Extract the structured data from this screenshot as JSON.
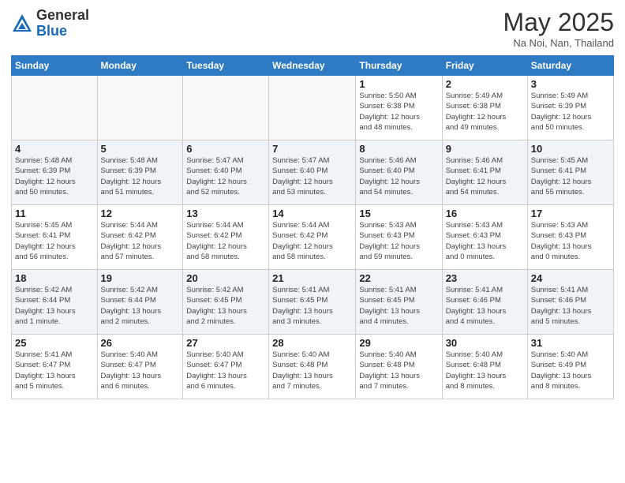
{
  "header": {
    "logo_general": "General",
    "logo_blue": "Blue",
    "month": "May 2025",
    "location": "Na Noi, Nan, Thailand"
  },
  "days_of_week": [
    "Sunday",
    "Monday",
    "Tuesday",
    "Wednesday",
    "Thursday",
    "Friday",
    "Saturday"
  ],
  "weeks": [
    [
      {
        "num": "",
        "info": "",
        "empty": true
      },
      {
        "num": "",
        "info": "",
        "empty": true
      },
      {
        "num": "",
        "info": "",
        "empty": true
      },
      {
        "num": "",
        "info": "",
        "empty": true
      },
      {
        "num": "1",
        "info": "Sunrise: 5:50 AM\nSunset: 6:38 PM\nDaylight: 12 hours\nand 48 minutes."
      },
      {
        "num": "2",
        "info": "Sunrise: 5:49 AM\nSunset: 6:38 PM\nDaylight: 12 hours\nand 49 minutes."
      },
      {
        "num": "3",
        "info": "Sunrise: 5:49 AM\nSunset: 6:39 PM\nDaylight: 12 hours\nand 50 minutes."
      }
    ],
    [
      {
        "num": "4",
        "info": "Sunrise: 5:48 AM\nSunset: 6:39 PM\nDaylight: 12 hours\nand 50 minutes."
      },
      {
        "num": "5",
        "info": "Sunrise: 5:48 AM\nSunset: 6:39 PM\nDaylight: 12 hours\nand 51 minutes."
      },
      {
        "num": "6",
        "info": "Sunrise: 5:47 AM\nSunset: 6:40 PM\nDaylight: 12 hours\nand 52 minutes."
      },
      {
        "num": "7",
        "info": "Sunrise: 5:47 AM\nSunset: 6:40 PM\nDaylight: 12 hours\nand 53 minutes."
      },
      {
        "num": "8",
        "info": "Sunrise: 5:46 AM\nSunset: 6:40 PM\nDaylight: 12 hours\nand 54 minutes."
      },
      {
        "num": "9",
        "info": "Sunrise: 5:46 AM\nSunset: 6:41 PM\nDaylight: 12 hours\nand 54 minutes."
      },
      {
        "num": "10",
        "info": "Sunrise: 5:45 AM\nSunset: 6:41 PM\nDaylight: 12 hours\nand 55 minutes."
      }
    ],
    [
      {
        "num": "11",
        "info": "Sunrise: 5:45 AM\nSunset: 6:41 PM\nDaylight: 12 hours\nand 56 minutes."
      },
      {
        "num": "12",
        "info": "Sunrise: 5:44 AM\nSunset: 6:42 PM\nDaylight: 12 hours\nand 57 minutes."
      },
      {
        "num": "13",
        "info": "Sunrise: 5:44 AM\nSunset: 6:42 PM\nDaylight: 12 hours\nand 58 minutes."
      },
      {
        "num": "14",
        "info": "Sunrise: 5:44 AM\nSunset: 6:42 PM\nDaylight: 12 hours\nand 58 minutes."
      },
      {
        "num": "15",
        "info": "Sunrise: 5:43 AM\nSunset: 6:43 PM\nDaylight: 12 hours\nand 59 minutes."
      },
      {
        "num": "16",
        "info": "Sunrise: 5:43 AM\nSunset: 6:43 PM\nDaylight: 13 hours\nand 0 minutes."
      },
      {
        "num": "17",
        "info": "Sunrise: 5:43 AM\nSunset: 6:43 PM\nDaylight: 13 hours\nand 0 minutes."
      }
    ],
    [
      {
        "num": "18",
        "info": "Sunrise: 5:42 AM\nSunset: 6:44 PM\nDaylight: 13 hours\nand 1 minute."
      },
      {
        "num": "19",
        "info": "Sunrise: 5:42 AM\nSunset: 6:44 PM\nDaylight: 13 hours\nand 2 minutes."
      },
      {
        "num": "20",
        "info": "Sunrise: 5:42 AM\nSunset: 6:45 PM\nDaylight: 13 hours\nand 2 minutes."
      },
      {
        "num": "21",
        "info": "Sunrise: 5:41 AM\nSunset: 6:45 PM\nDaylight: 13 hours\nand 3 minutes."
      },
      {
        "num": "22",
        "info": "Sunrise: 5:41 AM\nSunset: 6:45 PM\nDaylight: 13 hours\nand 4 minutes."
      },
      {
        "num": "23",
        "info": "Sunrise: 5:41 AM\nSunset: 6:46 PM\nDaylight: 13 hours\nand 4 minutes."
      },
      {
        "num": "24",
        "info": "Sunrise: 5:41 AM\nSunset: 6:46 PM\nDaylight: 13 hours\nand 5 minutes."
      }
    ],
    [
      {
        "num": "25",
        "info": "Sunrise: 5:41 AM\nSunset: 6:47 PM\nDaylight: 13 hours\nand 5 minutes."
      },
      {
        "num": "26",
        "info": "Sunrise: 5:40 AM\nSunset: 6:47 PM\nDaylight: 13 hours\nand 6 minutes."
      },
      {
        "num": "27",
        "info": "Sunrise: 5:40 AM\nSunset: 6:47 PM\nDaylight: 13 hours\nand 6 minutes."
      },
      {
        "num": "28",
        "info": "Sunrise: 5:40 AM\nSunset: 6:48 PM\nDaylight: 13 hours\nand 7 minutes."
      },
      {
        "num": "29",
        "info": "Sunrise: 5:40 AM\nSunset: 6:48 PM\nDaylight: 13 hours\nand 7 minutes."
      },
      {
        "num": "30",
        "info": "Sunrise: 5:40 AM\nSunset: 6:48 PM\nDaylight: 13 hours\nand 8 minutes."
      },
      {
        "num": "31",
        "info": "Sunrise: 5:40 AM\nSunset: 6:49 PM\nDaylight: 13 hours\nand 8 minutes."
      }
    ]
  ]
}
